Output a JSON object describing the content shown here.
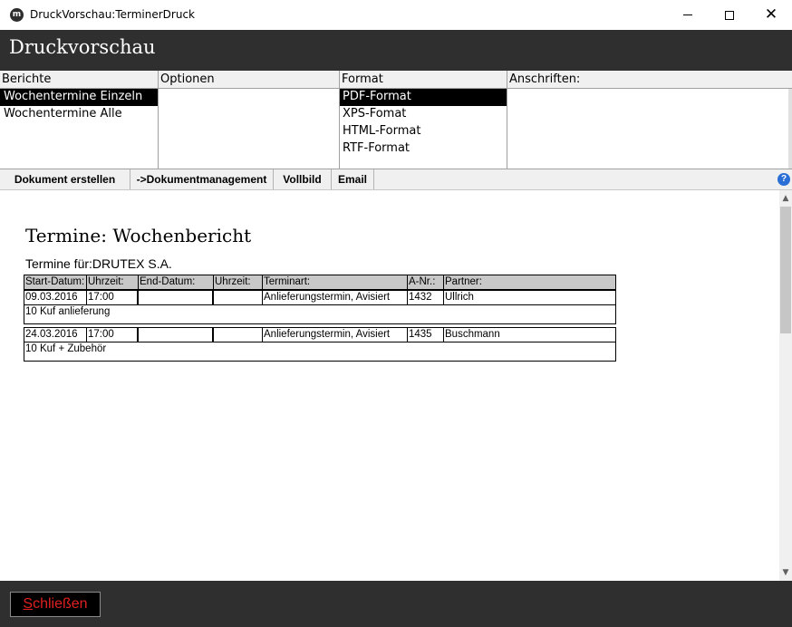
{
  "window": {
    "title": "DruckVorschau:TerminerDruck",
    "icon": "app-logo-icon",
    "minimize": "—",
    "maximize": "☐",
    "close": "✕"
  },
  "header": {
    "title": "Druckvorschau"
  },
  "panels": {
    "berichte": {
      "label": "Berichte",
      "items": [
        "Wochentermine Einzeln",
        "Wochentermine Alle"
      ],
      "selected": "Wochentermine Einzeln"
    },
    "optionen": {
      "label": "Optionen",
      "items": []
    },
    "format": {
      "label": "Format",
      "items": [
        "PDF-Format",
        "XPS-Fomat",
        "HTML-Format",
        "RTF-Format"
      ],
      "selected": "PDF-Format"
    },
    "anschriften": {
      "label": "Anschriften:",
      "items": []
    }
  },
  "toolbar": {
    "dokument_erstellen": "Dokument erstellen",
    "dokumentmanagement": "->Dokumentmanagement",
    "vollbild": "Vollbild",
    "email": "Email",
    "help_icon": "?"
  },
  "report": {
    "title": "Termine: Wochenbericht",
    "subtitle": "Termine für:DRUTEX S.A.",
    "columns": [
      "Start-Datum:",
      "Uhrzeit:",
      "End-Datum:",
      "Uhrzeit:",
      "Terminart:",
      "A-Nr.:",
      "Partner:"
    ],
    "records": [
      {
        "start_datum": "09.03.2016",
        "start_uhrzeit": "17:00",
        "end_datum": "",
        "end_uhrzeit": "",
        "terminart": "Anlieferungstermin, Avisiert",
        "a_nr": "1432",
        "partner": "Ullrich",
        "note": "10 Kuf anlieferung"
      },
      {
        "start_datum": "24.03.2016",
        "start_uhrzeit": "17:00",
        "end_datum": "",
        "end_uhrzeit": "",
        "terminart": "Anlieferungstermin, Avisiert",
        "a_nr": "1435",
        "partner": "Buschmann",
        "note": "10 Kuf + Zubehör"
      }
    ]
  },
  "footer": {
    "close_label_first": "S",
    "close_label_rest": "chließen",
    "close_color": "#e02020"
  },
  "colors": {
    "header_bg": "#2f2f2f",
    "selection_bg": "#000000",
    "table_header_bg": "#c8c8c8"
  }
}
